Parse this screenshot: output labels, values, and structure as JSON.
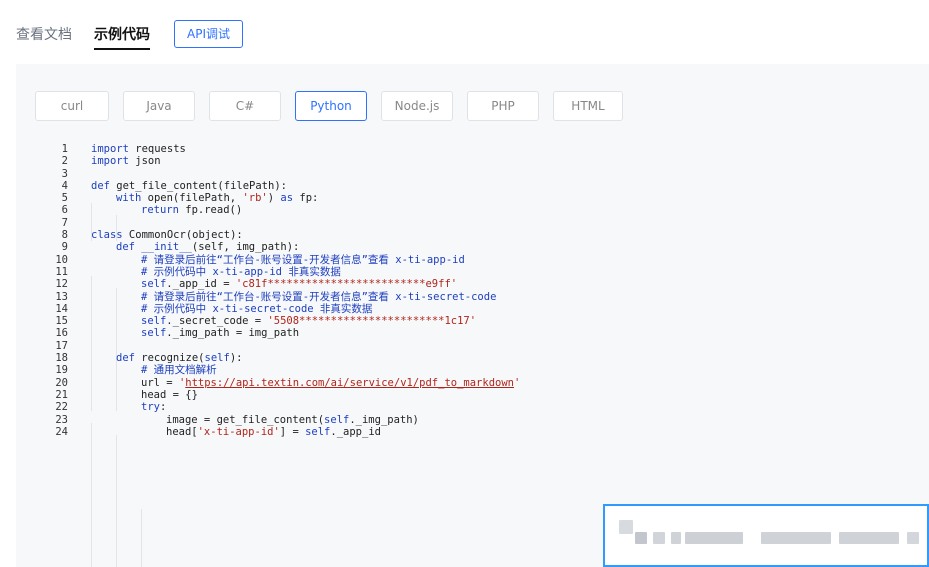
{
  "top_tabs": [
    {
      "label": "查看文档",
      "active": false
    },
    {
      "label": "示例代码",
      "active": true
    }
  ],
  "api_button": "API调试",
  "lang_tabs": [
    {
      "label": "curl",
      "active": false
    },
    {
      "label": "Java",
      "active": false
    },
    {
      "label": "C#",
      "active": false
    },
    {
      "label": "Python",
      "active": true
    },
    {
      "label": "Node.js",
      "active": false
    },
    {
      "label": "PHP",
      "active": false
    },
    {
      "label": "HTML",
      "active": false
    }
  ],
  "code": {
    "lines": [
      {
        "n": "1",
        "indent": 0,
        "t": [
          [
            "kw",
            "import"
          ],
          [
            "",
            "requests"
          ]
        ]
      },
      {
        "n": "2",
        "indent": 0,
        "t": [
          [
            "kw",
            "import"
          ],
          [
            "",
            "json"
          ]
        ]
      },
      {
        "n": "3",
        "indent": 0,
        "t": []
      },
      {
        "n": "4",
        "indent": 0,
        "t": [
          [
            "kw",
            "def"
          ],
          [
            "",
            " get_file_content(filePath):"
          ]
        ]
      },
      {
        "n": "5",
        "indent": 1,
        "t": [
          [
            "kw",
            "with"
          ],
          [
            "",
            " open(filePath, "
          ],
          [
            "str",
            "'rb'"
          ],
          [
            "",
            ") "
          ],
          [
            "kw",
            "as"
          ],
          [
            "",
            " fp:"
          ]
        ]
      },
      {
        "n": "6",
        "indent": 2,
        "t": [
          [
            "kw",
            "return"
          ],
          [
            "",
            " fp.read()"
          ]
        ]
      },
      {
        "n": "7",
        "indent": 0,
        "t": []
      },
      {
        "n": "8",
        "indent": 0,
        "t": [
          [
            "kw",
            "class"
          ],
          [
            "",
            " CommonOcr(object):"
          ]
        ]
      },
      {
        "n": "9",
        "indent": 1,
        "t": [
          [
            "kw",
            "def"
          ],
          [
            "",
            " "
          ],
          [
            "kw",
            "__init__"
          ],
          [
            "",
            "(self, img_path):"
          ]
        ]
      },
      {
        "n": "10",
        "indent": 2,
        "t": [
          [
            "cm",
            "# 请登录后前往“工作台-账号设置-开发者信息”查看 x-ti-app-id"
          ]
        ]
      },
      {
        "n": "11",
        "indent": 2,
        "t": [
          [
            "cm",
            "# 示例代码中 x-ti-app-id 非真实数据"
          ]
        ]
      },
      {
        "n": "12",
        "indent": 2,
        "t": [
          [
            "kw",
            "self"
          ],
          [
            "",
            "._app_id = "
          ],
          [
            "str",
            "'c81f*************************e9ff'"
          ]
        ]
      },
      {
        "n": "13",
        "indent": 2,
        "t": [
          [
            "cm",
            "# 请登录后前往“工作台-账号设置-开发者信息”查看 x-ti-secret-code"
          ]
        ]
      },
      {
        "n": "14",
        "indent": 2,
        "t": [
          [
            "cm",
            "# 示例代码中 x-ti-secret-code 非真实数据"
          ]
        ]
      },
      {
        "n": "15",
        "indent": 2,
        "t": [
          [
            "kw",
            "self"
          ],
          [
            "",
            "._secret_code = "
          ],
          [
            "str",
            "'5508***********************1c17'"
          ]
        ]
      },
      {
        "n": "16",
        "indent": 2,
        "t": [
          [
            "kw",
            "self"
          ],
          [
            "",
            "._img_path = img_path"
          ]
        ]
      },
      {
        "n": "17",
        "indent": 0,
        "t": []
      },
      {
        "n": "18",
        "indent": 1,
        "t": [
          [
            "kw",
            "def"
          ],
          [
            "",
            " recognize("
          ],
          [
            "kw",
            "self"
          ],
          [
            "",
            "):"
          ]
        ]
      },
      {
        "n": "19",
        "indent": 2,
        "t": [
          [
            "cm",
            "# 通用文档解析"
          ]
        ]
      },
      {
        "n": "20",
        "indent": 2,
        "t": [
          [
            "",
            "url = "
          ],
          [
            "str",
            "'"
          ],
          [
            "str url",
            "https://api.textin.com/ai/service/v1/pdf_to_markdown"
          ],
          [
            "str",
            "'"
          ]
        ]
      },
      {
        "n": "21",
        "indent": 2,
        "t": [
          [
            "",
            "head = {}"
          ]
        ]
      },
      {
        "n": "22",
        "indent": 2,
        "t": [
          [
            "kw",
            "try"
          ],
          [
            "",
            ":"
          ]
        ]
      },
      {
        "n": "23",
        "indent": 3,
        "t": [
          [
            "",
            "image = get_file_content("
          ],
          [
            "kw",
            "self"
          ],
          [
            "",
            "._img_path)"
          ]
        ]
      },
      {
        "n": "24",
        "indent": 3,
        "t": [
          [
            "",
            "head["
          ],
          [
            "str",
            "'x-ti-app-id'"
          ],
          [
            "",
            "] = "
          ],
          [
            "kw",
            "self"
          ],
          [
            "",
            "._app_id"
          ]
        ]
      }
    ]
  },
  "colors": {
    "accent": "#2f72ff",
    "keyword": "#1d3fbf",
    "string": "#b0251a"
  },
  "icons": {
    "overlay": "blurred-toast"
  }
}
